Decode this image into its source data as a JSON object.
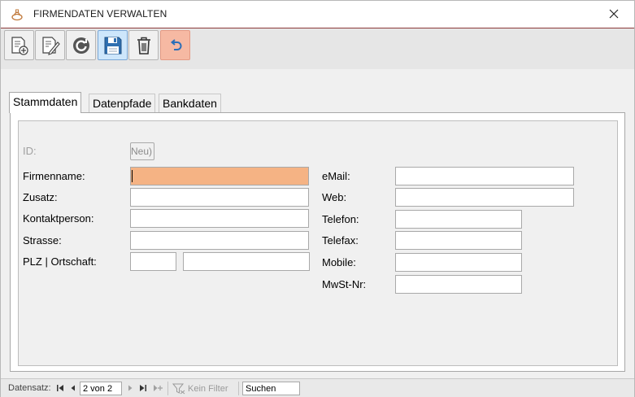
{
  "window": {
    "title": "FIRMENDATEN VERWALTEN"
  },
  "toolbar": {
    "buttons": [
      {
        "name": "new-record",
        "icon": "new-record-icon"
      },
      {
        "name": "edit-record",
        "icon": "edit-record-icon"
      },
      {
        "name": "refresh",
        "icon": "refresh-icon"
      },
      {
        "name": "save",
        "icon": "save-icon"
      },
      {
        "name": "delete",
        "icon": "trash-icon"
      },
      {
        "name": "undo",
        "icon": "undo-icon"
      }
    ]
  },
  "tabs": [
    {
      "label": "Stammdaten",
      "selected": true
    },
    {
      "label": "Datenpfade",
      "selected": false
    },
    {
      "label": "Bankdaten",
      "selected": false
    }
  ],
  "form": {
    "id": {
      "label": "ID:",
      "value": "(Neu)"
    },
    "left": [
      {
        "label": "Firmenname:",
        "value": ""
      },
      {
        "label": "Zusatz:",
        "value": ""
      },
      {
        "label": "Kontaktperson:",
        "value": ""
      },
      {
        "label": "Strasse:",
        "value": ""
      },
      {
        "label": "PLZ | Ortschaft:",
        "plz": "",
        "ort": ""
      }
    ],
    "right": [
      {
        "label": "eMail:",
        "value": ""
      },
      {
        "label": "Web:",
        "value": ""
      },
      {
        "label": "Telefon:",
        "value": ""
      },
      {
        "label": "Telefax:",
        "value": ""
      },
      {
        "label": "Mobile:",
        "value": ""
      },
      {
        "label": "MwSt-Nr:",
        "value": ""
      }
    ]
  },
  "navigation": {
    "label": "Datensatz:",
    "record": "2 von 2",
    "filter": "Kein Filter",
    "search": "Suchen"
  },
  "colors": {
    "focused_field": "#f5b384",
    "undo_button": "#f6b9a3",
    "save_button": "#cde6fb",
    "ribbon_border": "#8c3a3a"
  }
}
